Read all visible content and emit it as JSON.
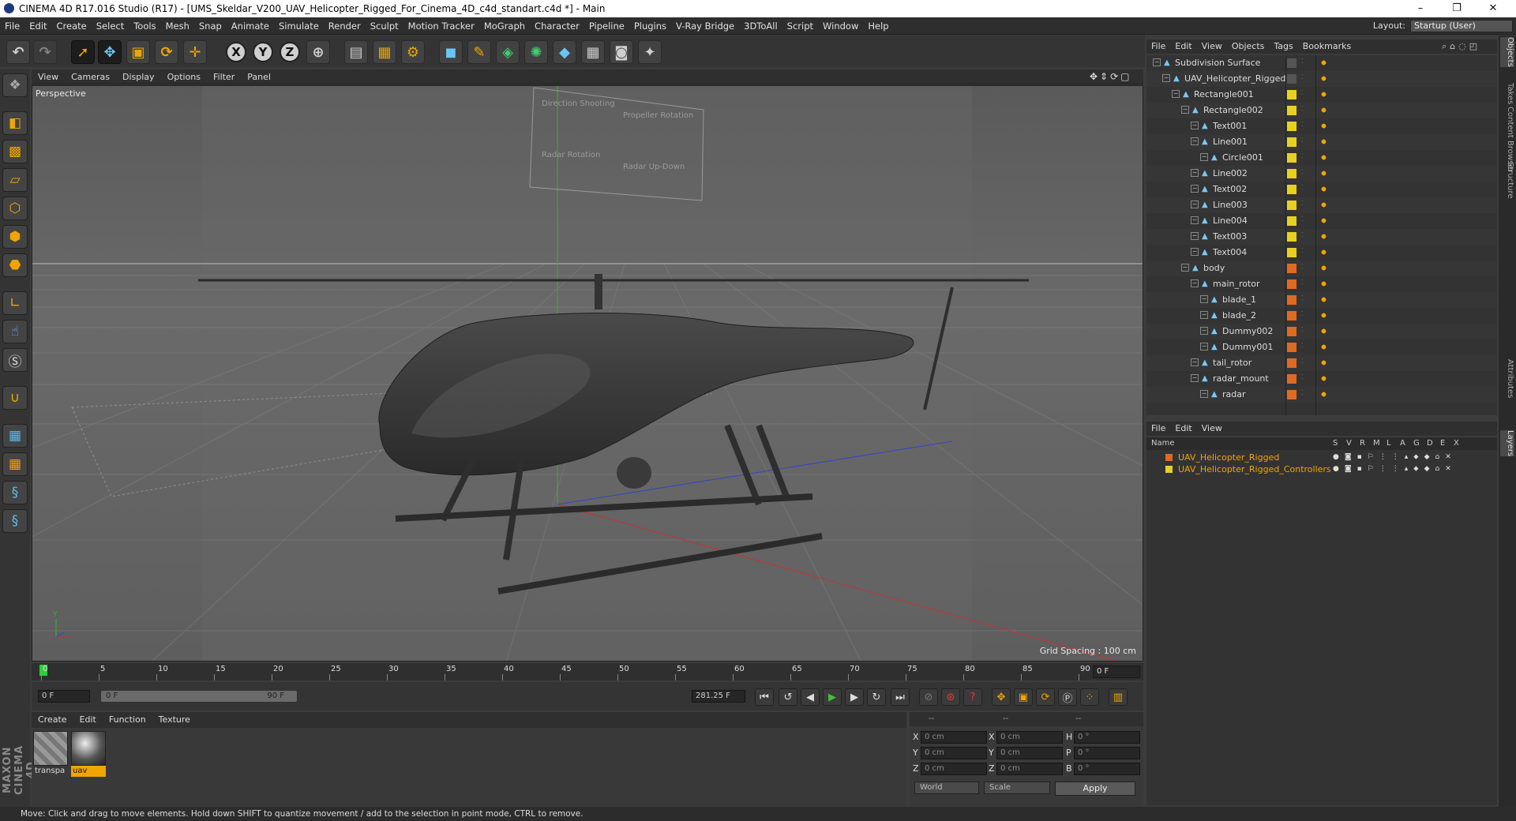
{
  "window": {
    "title": "CINEMA 4D R17.016 Studio (R17) - [UMS_Skeldar_V200_UAV_Helicopter_Rigged_For_Cinema_4D_c4d_standart.c4d *] - Main",
    "minimize": "–",
    "maximize": "❐",
    "close": "✕"
  },
  "menubar": {
    "items": [
      "File",
      "Edit",
      "Create",
      "Select",
      "Tools",
      "Mesh",
      "Snap",
      "Animate",
      "Simulate",
      "Render",
      "Sculpt",
      "Motion Tracker",
      "MoGraph",
      "Character",
      "Pipeline",
      "Plugins",
      "V-Ray Bridge",
      "3DToAll",
      "Script",
      "Window",
      "Help"
    ],
    "layout_label": "Layout:",
    "layout_value": "Startup (User)"
  },
  "viewport": {
    "menu": [
      "View",
      "Cameras",
      "Display",
      "Options",
      "Filter",
      "Panel"
    ],
    "label": "Perspective",
    "grid_spacing": "Grid Spacing : 100 cm",
    "billboard": [
      "Direction Shooting",
      "Propeller Rotation",
      "Radar Rotation",
      "Radar Up-Down"
    ]
  },
  "timeline": {
    "ticks": [
      "0",
      "5",
      "10",
      "15",
      "20",
      "25",
      "30",
      "35",
      "40",
      "45",
      "50",
      "55",
      "60",
      "65",
      "70",
      "75",
      "80",
      "85",
      "90"
    ],
    "current_frame": "0 F",
    "start_field": "0 F",
    "range_start": "0 F",
    "range_end": "90 F",
    "fps_field": "281.25 F"
  },
  "materials": {
    "menu": [
      "Create",
      "Edit",
      "Function",
      "Texture"
    ],
    "items": [
      {
        "name": "transpa"
      },
      {
        "name": "uav"
      }
    ]
  },
  "coordinates": {
    "header": [
      "--",
      "--",
      "--"
    ],
    "rows": [
      {
        "l1": "X",
        "v1": "0 cm",
        "l2": "X",
        "v2": "0 cm",
        "l3": "H",
        "v3": "0 °"
      },
      {
        "l1": "Y",
        "v1": "0 cm",
        "l2": "Y",
        "v2": "0 cm",
        "l3": "P",
        "v3": "0 °"
      },
      {
        "l1": "Z",
        "v1": "0 cm",
        "l2": "Z",
        "v2": "0 cm",
        "l3": "B",
        "v3": "0 °"
      }
    ],
    "mode": "World",
    "scale": "Scale",
    "apply": "Apply"
  },
  "status": "Move: Click and drag to move elements. Hold down SHIFT to quantize movement / add to the selection in point mode, CTRL to remove.",
  "object_manager": {
    "menu": [
      "File",
      "Edit",
      "View",
      "Objects",
      "Tags",
      "Bookmarks"
    ],
    "objects": [
      {
        "name": "Subdivision Surface",
        "indent": 0,
        "color": "#555555"
      },
      {
        "name": "UAV_Helicopter_Rigged",
        "indent": 1,
        "color": "#555555"
      },
      {
        "name": "Rectangle001",
        "indent": 2,
        "color": "#e8d020"
      },
      {
        "name": "Rectangle002",
        "indent": 3,
        "color": "#e8d020"
      },
      {
        "name": "Text001",
        "indent": 4,
        "color": "#e8d020"
      },
      {
        "name": "Line001",
        "indent": 4,
        "color": "#e8d020"
      },
      {
        "name": "Circle001",
        "indent": 5,
        "color": "#e8d020"
      },
      {
        "name": "Line002",
        "indent": 4,
        "color": "#e8d020"
      },
      {
        "name": "Text002",
        "indent": 4,
        "color": "#e8d020"
      },
      {
        "name": "Line003",
        "indent": 4,
        "color": "#e8d020"
      },
      {
        "name": "Line004",
        "indent": 4,
        "color": "#e8d020"
      },
      {
        "name": "Text003",
        "indent": 4,
        "color": "#e8d020"
      },
      {
        "name": "Text004",
        "indent": 4,
        "color": "#e8d020"
      },
      {
        "name": "body",
        "indent": 3,
        "color": "#e06a20"
      },
      {
        "name": "main_rotor",
        "indent": 4,
        "color": "#e06a20"
      },
      {
        "name": "blade_1",
        "indent": 5,
        "color": "#e06a20"
      },
      {
        "name": "blade_2",
        "indent": 5,
        "color": "#e06a20"
      },
      {
        "name": "Dummy002",
        "indent": 5,
        "color": "#e06a20"
      },
      {
        "name": "Dummy001",
        "indent": 5,
        "color": "#e06a20"
      },
      {
        "name": "tail_rotor",
        "indent": 4,
        "color": "#e06a20"
      },
      {
        "name": "radar_mount",
        "indent": 4,
        "color": "#e06a20"
      },
      {
        "name": "radar",
        "indent": 5,
        "color": "#e06a20"
      }
    ]
  },
  "layer_manager": {
    "menu": [
      "File",
      "Edit",
      "View"
    ],
    "columns": [
      "Name",
      "S",
      "V",
      "R",
      "M",
      "L",
      "A",
      "G",
      "D",
      "E",
      "X"
    ],
    "layers": [
      {
        "name": "UAV_Helicopter_Rigged",
        "color": "#e06a20"
      },
      {
        "name": "UAV_Helicopter_Rigged_Controllers",
        "color": "#e8d020"
      }
    ]
  },
  "right_tabs": [
    "Objects",
    "Takes",
    "Content Browser",
    "Structure",
    "Attributes",
    "Layers"
  ]
}
